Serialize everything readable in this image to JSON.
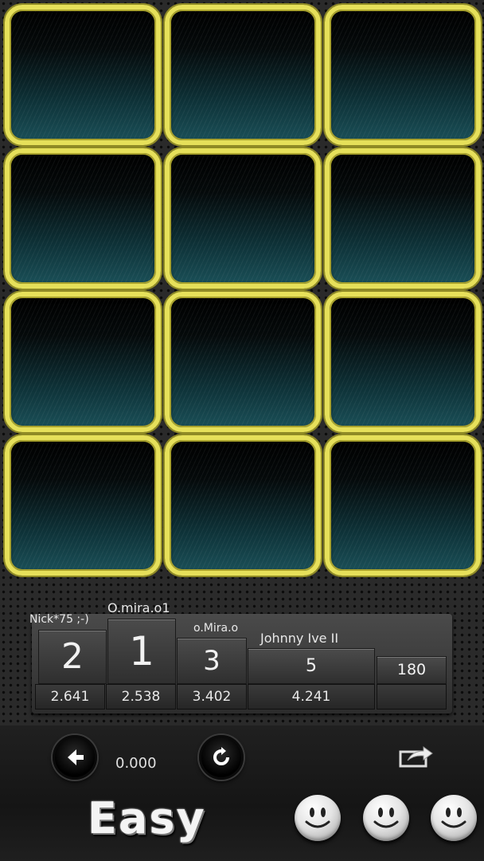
{
  "leaderboard": {
    "players": [
      {
        "name": "Nick*75 ;-)",
        "rank": "2",
        "time": "2.641"
      },
      {
        "name": "O.mira.o1",
        "rank": "1",
        "time": "2.538"
      },
      {
        "name": "o.Mira.o",
        "rank": "3",
        "time": "3.402"
      },
      {
        "name": "Johnny Ive II",
        "rank": "5",
        "time": "4.241"
      },
      {
        "name": "",
        "rank": "180",
        "time": ""
      }
    ]
  },
  "controls": {
    "timer": "0.000",
    "back_icon": "arrow-left-icon",
    "restart_icon": "refresh-icon",
    "share_icon": "share-icon"
  },
  "level": {
    "label": "Easy"
  },
  "colors": {
    "tile_border": "#e6e05a",
    "tile_face": "#0e3238"
  }
}
